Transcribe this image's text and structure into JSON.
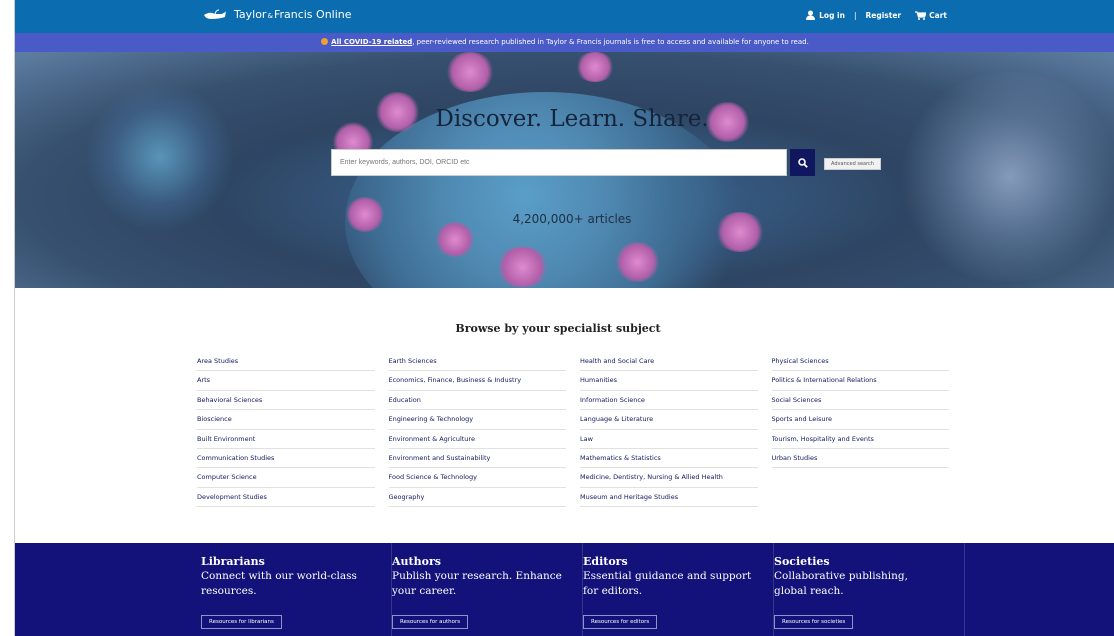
{
  "colors": {
    "brand": "#0b6db0",
    "banner": "#4a5ac6",
    "navy": "#12127a"
  },
  "header": {
    "logo_name": "Taylor",
    "logo_amp": "&",
    "logo_rest": "Francis Online",
    "login": "Log in",
    "separator": "|",
    "register": "Register",
    "cart": "Cart"
  },
  "banner": {
    "link": "All COVID-19 related",
    "text": ", peer-reviewed research published in Taylor & Francis journals is free to access and available for anyone to read."
  },
  "hero": {
    "title": "Discover. Learn. Share.",
    "search_placeholder": "Enter keywords, authors, DOI, ORCID etc",
    "advanced": "Advanced search",
    "count": "4,200,000+ articles"
  },
  "browse": {
    "title": "Browse by your specialist subject",
    "columns": [
      [
        "Area Studies",
        "Arts",
        "Behavioral Sciences",
        "Bioscience",
        "Built Environment",
        "Communication Studies",
        "Computer Science",
        "Development Studies"
      ],
      [
        "Earth Sciences",
        "Economics, Finance, Business & Industry",
        "Education",
        "Engineering & Technology",
        "Environment & Agriculture",
        "Environment and Sustainability",
        "Food Science & Technology",
        "Geography"
      ],
      [
        "Health and Social Care",
        "Humanities",
        "Information Science",
        "Language & Literature",
        "Law",
        "Mathematics & Statistics",
        "Medicine, Dentistry, Nursing & Allied Health",
        "Museum and Heritage Studies"
      ],
      [
        "Physical Sciences",
        "Politics & International Relations",
        "Social Sciences",
        "Sports and Leisure",
        "Tourism, Hospitality and Events",
        "Urban Studies"
      ]
    ]
  },
  "roles": [
    {
      "title": "Librarians",
      "text": "Connect with our world-class resources.",
      "button": "Resources for librarians"
    },
    {
      "title": "Authors",
      "text": "Publish your research. Enhance your career.",
      "button": "Resources for authors"
    },
    {
      "title": "Editors",
      "text": "Essential guidance and support for editors.",
      "button": "Resources for editors"
    },
    {
      "title": "Societies",
      "text": "Collaborative publishing, global reach.",
      "button": "Resources for societies"
    }
  ]
}
